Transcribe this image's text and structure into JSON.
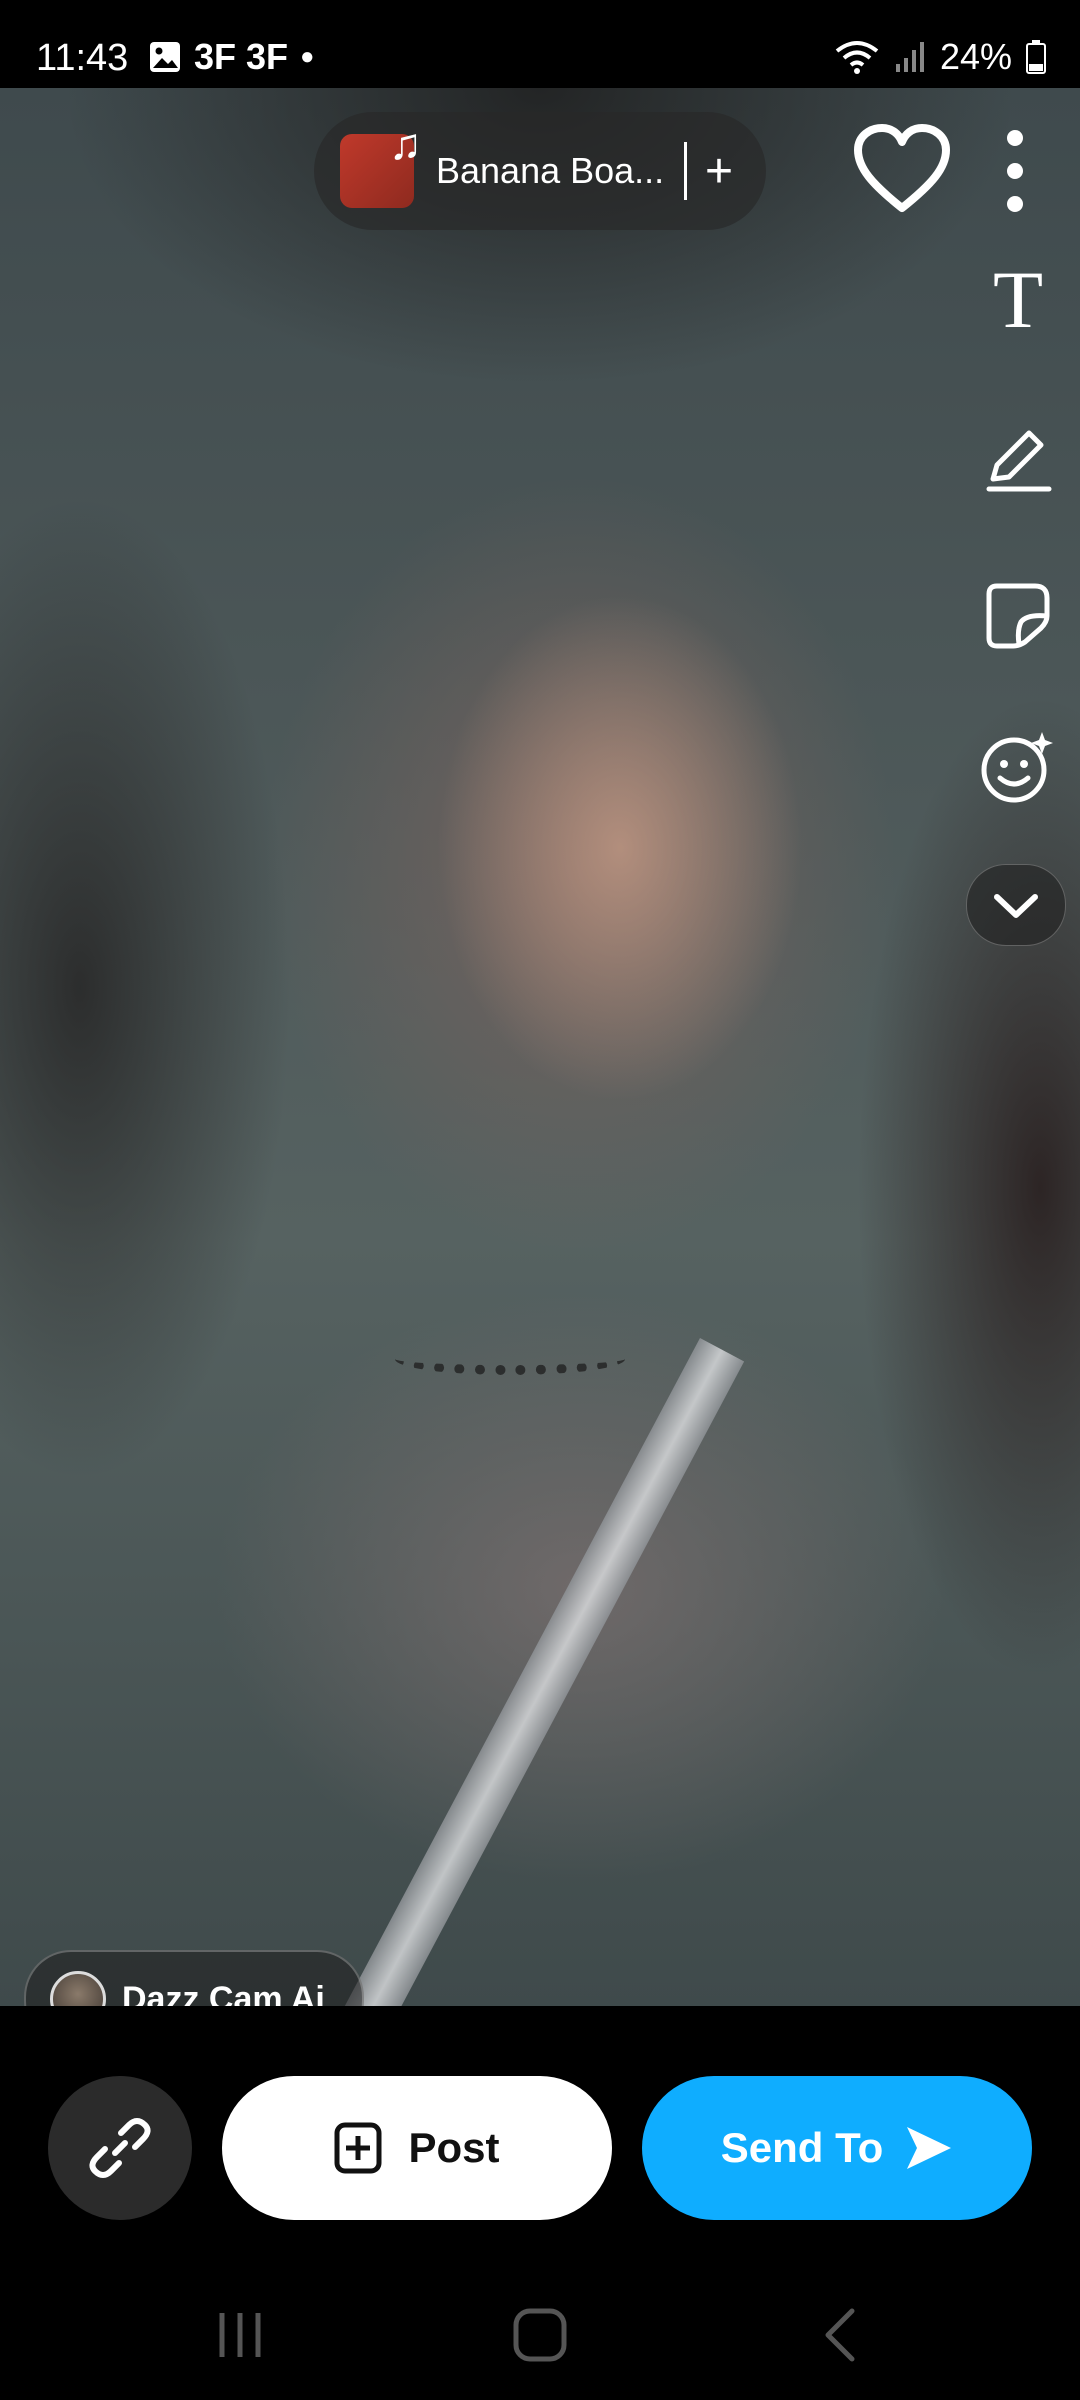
{
  "status_bar": {
    "time": "11:43",
    "carrier_icons": "3F 3F",
    "battery": "24%"
  },
  "music": {
    "title": "Banana Boa...",
    "add": "+"
  },
  "toolbar": {
    "text_tool": "T"
  },
  "lens": {
    "label": "Dazz Cam Ai"
  },
  "actions": {
    "post_label": "Post",
    "send_label": "Send To"
  },
  "colors": {
    "send_button": "#0fadff",
    "post_button": "#ffffff"
  }
}
